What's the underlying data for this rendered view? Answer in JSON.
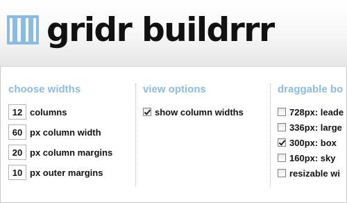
{
  "header": {
    "logo_text": "gridr buildrrr"
  },
  "choose_widths": {
    "title": "choose widths",
    "fields": [
      {
        "value": "12",
        "label": "columns"
      },
      {
        "value": "60",
        "label": "px column width"
      },
      {
        "value": "20",
        "label": "px column margins"
      },
      {
        "value": "10",
        "label": "px outer margins"
      }
    ]
  },
  "view_options": {
    "title": "view options",
    "items": [
      {
        "label": "show column widths",
        "checked": true
      }
    ]
  },
  "draggable_boxes": {
    "title": "draggable bo",
    "items": [
      {
        "label": "728px: leade",
        "checked": false
      },
      {
        "label": "336px: large",
        "checked": false
      },
      {
        "label": "300px: box",
        "checked": true
      },
      {
        "label": "160px: sky",
        "checked": false
      },
      {
        "label": "resizable wi",
        "checked": false
      }
    ]
  },
  "colors": {
    "accent": "#8bbcdf",
    "text": "#111111"
  }
}
